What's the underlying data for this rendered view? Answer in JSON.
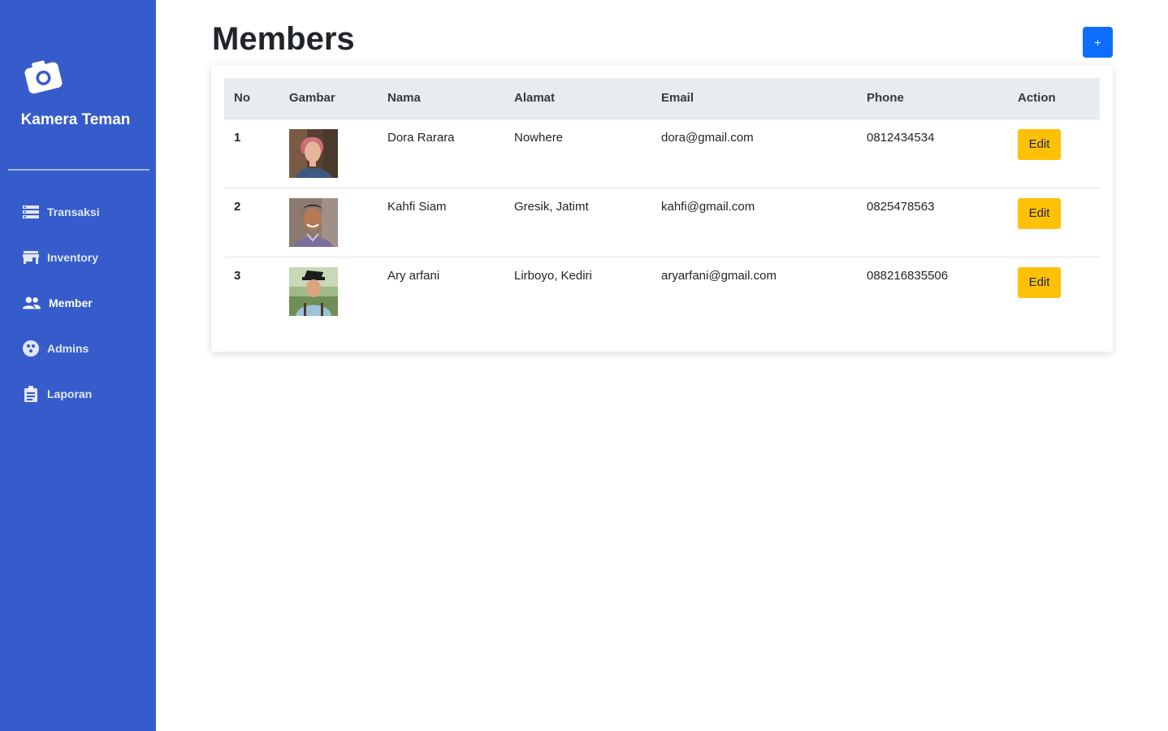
{
  "sidebar": {
    "brand": "Kamera Teman",
    "logo_icon": "camera-icon",
    "items": [
      {
        "label": "Transaksi",
        "icon": "list-icon"
      },
      {
        "label": "Inventory",
        "icon": "store-icon"
      },
      {
        "label": "Member",
        "icon": "people-icon"
      },
      {
        "label": "Admins",
        "icon": "admin-icon"
      },
      {
        "label": "Laporan",
        "icon": "clipboard-icon"
      }
    ],
    "active": "Member",
    "colors": {
      "background": "#365ccb",
      "text": "#ffffff"
    }
  },
  "header": {
    "title": "Members",
    "add_label": "+"
  },
  "table": {
    "columns": [
      "No",
      "Gambar",
      "Nama",
      "Alamat",
      "Email",
      "Phone",
      "Action"
    ],
    "rows": [
      {
        "no": "1",
        "nama": "Dora Rarara",
        "alamat": "Nowhere",
        "email": "dora@gmail.com",
        "phone": "0812434534",
        "action": "Edit"
      },
      {
        "no": "2",
        "nama": "Kahfi Siam",
        "alamat": "Gresik, Jatimt",
        "email": "kahfi@gmail.com",
        "phone": "0825478563",
        "action": "Edit"
      },
      {
        "no": "3",
        "nama": "Ary arfani",
        "alamat": "Lirboyo, Kediri",
        "email": "aryarfani@gmail.com",
        "phone": "088216835506",
        "action": "Edit"
      }
    ]
  },
  "colors": {
    "primary": "#0d6efd",
    "warning": "#ffc107",
    "header_bg": "#e9ecef"
  }
}
